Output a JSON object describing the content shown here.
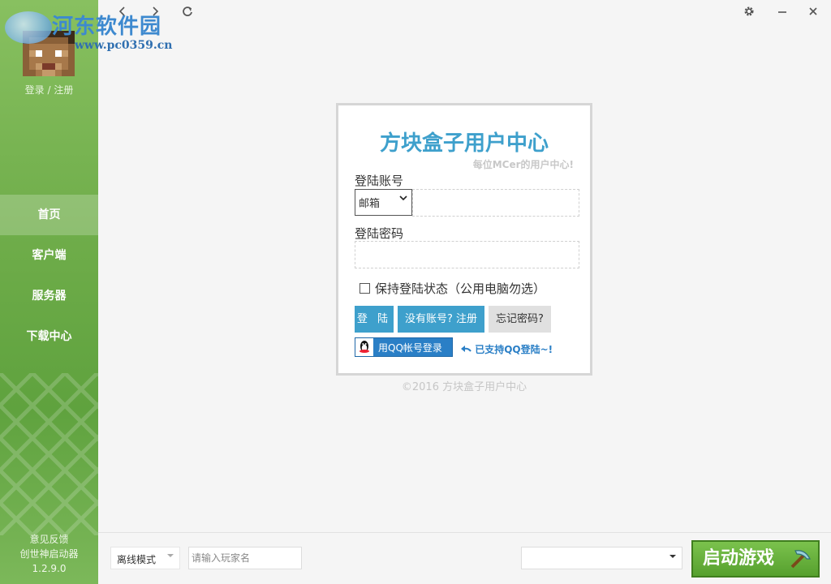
{
  "watermark": {
    "title": "河东软件园",
    "url": "www.pc0359.cn"
  },
  "sidebar": {
    "login_link": "登录 / 注册",
    "items": [
      {
        "label": "首页",
        "active": true
      },
      {
        "label": "客户端"
      },
      {
        "label": "服务器"
      },
      {
        "label": "下载中心"
      }
    ],
    "footer": {
      "feedback": "意见反馈",
      "app_name": "创世神启动器",
      "version": "1.2.9.0"
    }
  },
  "topbar": {
    "back_icon": "chevron-left-icon",
    "forward_icon": "chevron-right-icon",
    "refresh_icon": "refresh-icon",
    "settings_icon": "gear-icon",
    "minimize_icon": "minimize-icon",
    "close_icon": "close-icon"
  },
  "login": {
    "title": "方块盒子用户中心",
    "subtitle": "每位MCer的用户中心!",
    "account_label": "登陆账号",
    "account_type": "邮箱",
    "password_label": "登陆密码",
    "remember_label": "保持登陆状态（公用电脑勿选）",
    "login_button": "登 陆",
    "register_button": "没有账号? 注册",
    "forgot_button": "忘记密码?",
    "qq_button": "用QQ帐号登录",
    "qq_note": "已支持QQ登陆~!",
    "copyright": "©2016 方块盒子用户中心"
  },
  "bottom": {
    "mode": "离线模式",
    "player_placeholder": "请输入玩家名",
    "version_value": "",
    "launch_button": "启动游戏"
  },
  "colors": {
    "accent_blue": "#3ea0cc",
    "sidebar_green": "#6fad4a",
    "launch_green": "#56a02e"
  }
}
